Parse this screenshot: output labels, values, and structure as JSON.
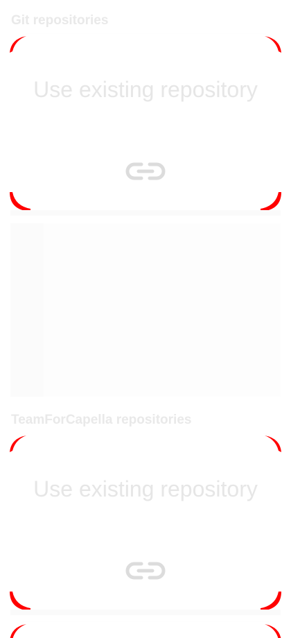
{
  "sections": [
    {
      "title": "Git repositories",
      "card": {
        "label": "Use existing repository",
        "icon": "link-icon"
      }
    },
    {
      "title": "TeamForCapella repositories",
      "card": {
        "label": "Use existing repository",
        "icon": "link-icon"
      }
    }
  ],
  "colors": {
    "corner_marker": "#ff0000",
    "title_text": "#e9e9e9",
    "card_text": "#e6e6e6",
    "icon": "#dcdcdc"
  }
}
